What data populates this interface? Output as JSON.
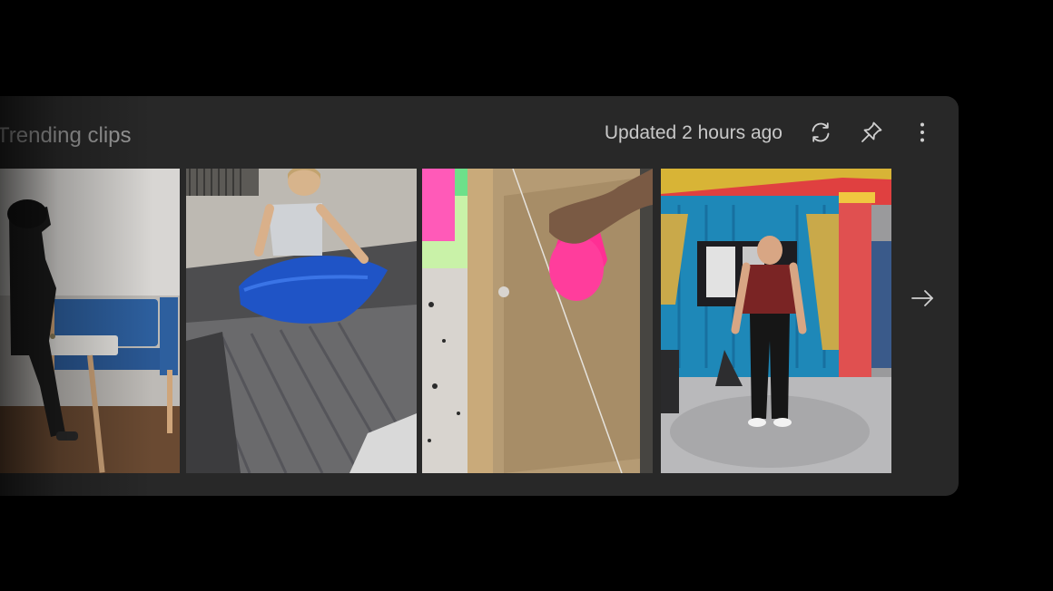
{
  "widget": {
    "title": "Trending clips",
    "status": "Updated 2 hours ago"
  },
  "toolbar": {
    "icons": [
      "refresh-icon",
      "pin-icon",
      "more-options-icon"
    ]
  },
  "clips": [
    {
      "name": "clip-person-waiting-room"
    },
    {
      "name": "clip-woman-blue-tarp-truck"
    },
    {
      "name": "clip-pink-paint-pour"
    },
    {
      "name": "clip-man-game-show-stage"
    }
  ],
  "navigation": {
    "next_icon": "arrow-right-icon"
  }
}
